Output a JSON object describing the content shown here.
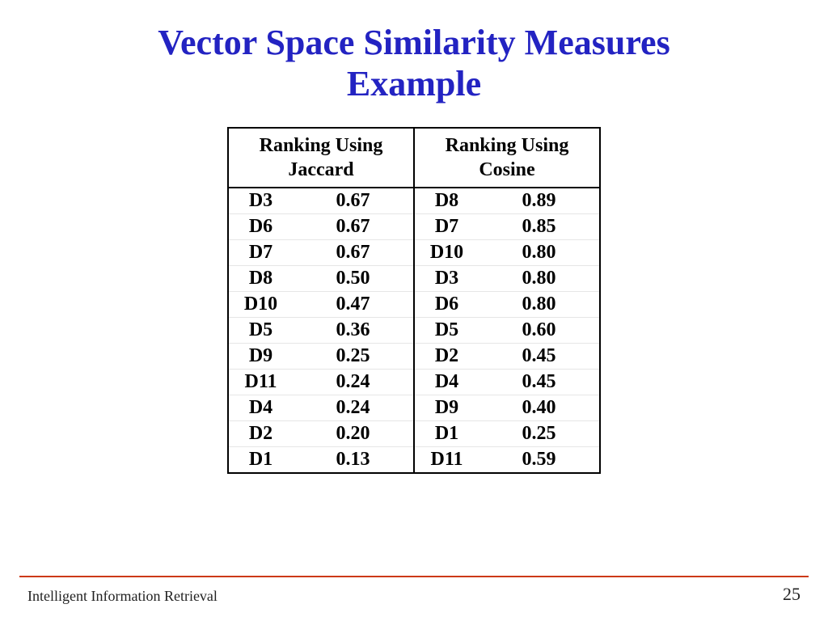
{
  "title_line1": "Vector Space Similarity Measures",
  "title_line2": "Example",
  "headers": {
    "left_line1": "Ranking Using",
    "left_line2": "Jaccard",
    "right_line1": "Ranking Using",
    "right_line2": "Cosine"
  },
  "rows": [
    {
      "j_doc": "D3",
      "j_val": "0.67",
      "c_doc": "D8",
      "c_val": "0.89"
    },
    {
      "j_doc": "D6",
      "j_val": "0.67",
      "c_doc": "D7",
      "c_val": "0.85"
    },
    {
      "j_doc": "D7",
      "j_val": "0.67",
      "c_doc": "D10",
      "c_val": "0.80"
    },
    {
      "j_doc": "D8",
      "j_val": "0.50",
      "c_doc": "D3",
      "c_val": "0.80"
    },
    {
      "j_doc": "D10",
      "j_val": "0.47",
      "c_doc": "D6",
      "c_val": "0.80"
    },
    {
      "j_doc": "D5",
      "j_val": "0.36",
      "c_doc": "D5",
      "c_val": "0.60"
    },
    {
      "j_doc": "D9",
      "j_val": "0.25",
      "c_doc": "D2",
      "c_val": "0.45"
    },
    {
      "j_doc": "D11",
      "j_val": "0.24",
      "c_doc": "D4",
      "c_val": "0.45"
    },
    {
      "j_doc": "D4",
      "j_val": "0.24",
      "c_doc": "D9",
      "c_val": "0.40"
    },
    {
      "j_doc": "D2",
      "j_val": "0.20",
      "c_doc": "D1",
      "c_val": "0.25"
    },
    {
      "j_doc": "D1",
      "j_val": "0.13",
      "c_doc": "D11",
      "c_val": "0.59"
    }
  ],
  "footer": "Intelligent Information Retrieval",
  "page_number": "25",
  "chart_data": {
    "type": "table",
    "title": "Vector Space Similarity Measures Example",
    "columns": [
      "Jaccard Doc",
      "Jaccard Score",
      "Cosine Doc",
      "Cosine Score"
    ],
    "rows": [
      [
        "D3",
        0.67,
        "D8",
        0.89
      ],
      [
        "D6",
        0.67,
        "D7",
        0.85
      ],
      [
        "D7",
        0.67,
        "D10",
        0.8
      ],
      [
        "D8",
        0.5,
        "D3",
        0.8
      ],
      [
        "D10",
        0.47,
        "D6",
        0.8
      ],
      [
        "D5",
        0.36,
        "D5",
        0.6
      ],
      [
        "D9",
        0.25,
        "D2",
        0.45
      ],
      [
        "D11",
        0.24,
        "D4",
        0.45
      ],
      [
        "D4",
        0.24,
        "D9",
        0.4
      ],
      [
        "D2",
        0.2,
        "D1",
        0.25
      ],
      [
        "D1",
        0.13,
        "D11",
        0.59
      ]
    ]
  }
}
